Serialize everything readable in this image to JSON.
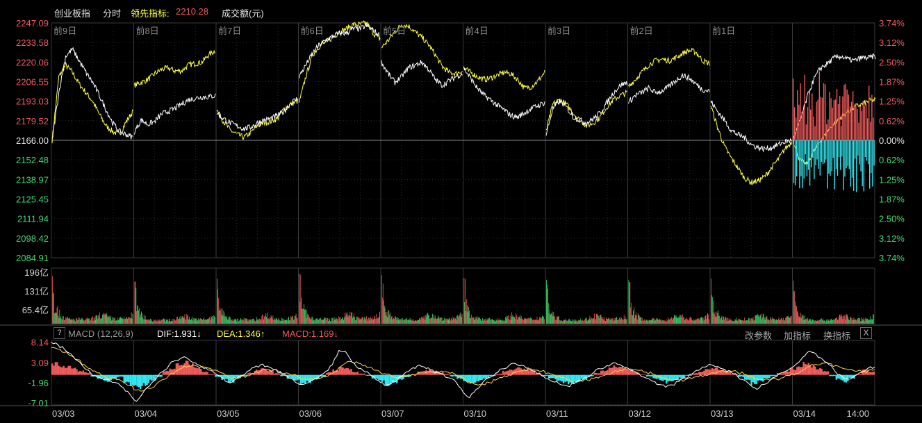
{
  "header": {
    "index_name": "创业板指",
    "mode": "分时",
    "leading_label": "领先指标:",
    "leading_value": "2210.28",
    "volume_label": "成交额(元)"
  },
  "colors": {
    "background": "#000000",
    "grid": "#2b2b2b",
    "up": "#f05b5b",
    "down": "#3fd96b",
    "price_line": "#ffffff",
    "leading_line": "#ffff40",
    "macd_neg": "#33e6f0",
    "dea": "#ffd54a"
  },
  "chart_data": [
    {
      "type": "line",
      "y_axis_left": [
        "2247.09",
        "2233.58",
        "2220.06",
        "2206.55",
        "2193.03",
        "2179.52",
        "2166.00",
        "2152.48",
        "2138.97",
        "2125.45",
        "2111.94",
        "2098.42",
        "2084.91"
      ],
      "y_axis_right": [
        "3.74%",
        "3.12%",
        "2.50%",
        "1.87%",
        "1.25%",
        "0.62%",
        "0.00%",
        "0.62%",
        "1.25%",
        "1.87%",
        "2.50%",
        "3.12%",
        "3.74%"
      ],
      "ylim": [
        2084.91,
        2247.09
      ],
      "baseline": 2166.0,
      "day_labels": [
        "前9日",
        "前8日",
        "前7日",
        "前6日",
        "前5日",
        "前4日",
        "前3日",
        "前2日",
        "前1日"
      ],
      "series": [
        {
          "name": "创业板指",
          "days": [
            [
              2166,
              2199,
              2224,
              2229,
              2221,
              2213,
              2206,
              2197,
              2187,
              2178,
              2172,
              2170,
              2168
            ],
            [
              2172,
              2180,
              2177,
              2179,
              2184,
              2186,
              2188,
              2191,
              2194,
              2195,
              2196,
              2196,
              2197
            ],
            [
              2185,
              2181,
              2178,
              2176,
              2174,
              2175,
              2178,
              2180,
              2181,
              2183,
              2186,
              2192,
              2195
            ],
            [
              2210,
              2218,
              2226,
              2232,
              2235,
              2238,
              2240,
              2240,
              2243,
              2243,
              2245,
              2242,
              2238
            ],
            [
              2220,
              2212,
              2206,
              2210,
              2216,
              2218,
              2220,
              2215,
              2208,
              2204,
              2207,
              2210,
              2212
            ],
            [
              2216,
              2209,
              2202,
              2197,
              2194,
              2190,
              2187,
              2183,
              2182,
              2185,
              2188,
              2190,
              2192
            ],
            [
              2170,
              2188,
              2193,
              2189,
              2182,
              2180,
              2178,
              2181,
              2185,
              2192,
              2199,
              2204,
              2206
            ],
            [
              2192,
              2197,
              2199,
              2202,
              2199,
              2200,
              2203,
              2207,
              2211,
              2209,
              2205,
              2201,
              2200
            ],
            [
              2193,
              2186,
              2180,
              2173,
              2170,
              2168,
              2163,
              2161,
              2160,
              2161,
              2163,
              2165,
              2166
            ],
            [
              2166,
              2179,
              2195,
              2208,
              2216,
              2219,
              2223,
              2224,
              2222,
              2221,
              2223,
              2223,
              2224
            ]
          ]
        },
        {
          "name": "领先指标",
          "days": [
            [
              2166,
              2210,
              2218,
              2213,
              2205,
              2199,
              2193,
              2184,
              2176,
              2172,
              2170,
              2179,
              2186
            ],
            [
              2204,
              2206,
              2208,
              2212,
              2215,
              2216,
              2214,
              2214,
              2218,
              2219,
              2220,
              2225,
              2228
            ],
            [
              2187,
              2179,
              2173,
              2170,
              2168,
              2171,
              2176,
              2178,
              2179,
              2181,
              2188,
              2191,
              2193
            ],
            [
              2192,
              2210,
              2225,
              2231,
              2234,
              2237,
              2241,
              2243,
              2246,
              2246,
              2247,
              2240,
              2236
            ],
            [
              2230,
              2235,
              2241,
              2246,
              2245,
              2241,
              2237,
              2232,
              2225,
              2217,
              2213,
              2212,
              2214
            ],
            [
              2216,
              2213,
              2210,
              2208,
              2209,
              2211,
              2213,
              2212,
              2208,
              2202,
              2203,
              2207,
              2213
            ],
            [
              2172,
              2191,
              2194,
              2191,
              2185,
              2180,
              2176,
              2178,
              2182,
              2189,
              2194,
              2197,
              2199
            ],
            [
              2203,
              2208,
              2213,
              2218,
              2221,
              2222,
              2221,
              2223,
              2226,
              2228,
              2227,
              2221,
              2219
            ],
            [
              2190,
              2175,
              2162,
              2154,
              2147,
              2140,
              2137,
              2138,
              2141,
              2147,
              2153,
              2160,
              2165
            ],
            [
              2166,
              2152,
              2149,
              2158,
              2166,
              2172,
              2178,
              2182,
              2186,
              2189,
              2191,
              2193,
              2194
            ]
          ]
        }
      ]
    },
    {
      "type": "bar",
      "y_axis_left": [
        "196亿",
        "131亿",
        "65.4亿"
      ],
      "ylim": [
        0,
        196
      ],
      "day_volume_profile": [
        120,
        62,
        46,
        34,
        28,
        24,
        20,
        18,
        16,
        14,
        14,
        14,
        16,
        16,
        15,
        14,
        14,
        16,
        14,
        15,
        18,
        20,
        22,
        26,
        30,
        30,
        28,
        26,
        22,
        20,
        18,
        18,
        16,
        16,
        17,
        18,
        18,
        20,
        22,
        24,
        28
      ],
      "day_scale": [
        1.0,
        0.88,
        0.94,
        1.05,
        1.02,
        0.96,
        0.92,
        0.92,
        0.95,
        0.9
      ]
    },
    {
      "type": "line",
      "title": "MACD (12,26,9)",
      "dif_label": "DIF:1.931",
      "dea_label": "DEA:1.346",
      "macd_label": "MACD:1.169",
      "y_axis_left": [
        "8.14",
        "3.09",
        "-1.96",
        "-7.01"
      ],
      "ylim": [
        -7.5,
        8.6
      ],
      "macd_histogram": [
        3,
        2.4,
        2.2,
        1.6,
        1,
        0.6,
        -0.4,
        -1.1,
        -1.6,
        -1.2,
        -0.5,
        -1.8,
        -2.6,
        -3.4,
        -2.4,
        -1.5,
        -0.6,
        0.9,
        1.8,
        2.6,
        3.2,
        2.5,
        1.6,
        0.8,
        0.2,
        -0.5,
        -1.2,
        -1.8,
        -0.9,
        -0.3,
        0.5,
        1.2,
        1.6,
        1.1,
        0.4,
        -0.3,
        -0.9,
        -1.5,
        -2.2,
        -1.9,
        -1.1,
        -0.4,
        0.6,
        1.3,
        1.8,
        1.6,
        0.8,
        0.3,
        -0.2,
        -0.9,
        -1.6,
        -2.5,
        -1.9,
        -1.2,
        -0.5,
        0.2,
        0.8,
        1.2,
        1.0,
        0.6,
        0.2,
        -0.4,
        -1.0,
        -1.6,
        -2.0,
        -1.5,
        -0.9,
        -0.3,
        0.3,
        0.9,
        1.4,
        1.8,
        1.5,
        1.0,
        0.4,
        -0.3,
        -0.8,
        -1.4,
        -1.9,
        -2.4,
        -1.8,
        -1.1,
        -0.4,
        0.5,
        1.0,
        1.6,
        2.2,
        1.8,
        1.3,
        0.7,
        0.1,
        -0.4,
        -0.9,
        -1.4,
        -1.9,
        -1.4,
        -0.8,
        -0.2,
        0.4,
        0.9,
        1.4,
        1.7,
        1.3,
        0.9,
        0.3,
        -0.5,
        -1.2,
        -2.3,
        -1.5,
        -0.9,
        -0.3,
        0.4,
        1.0,
        1.6,
        2.3,
        2.9,
        2.4,
        1.6,
        0.9,
        -0.3,
        -1.2,
        -1.8,
        -0.9,
        0.2,
        1.3,
        0.9
      ],
      "dif": [
        8.1,
        7.5,
        6.4,
        5.2,
        3.5,
        1.8,
        0.5,
        -0.6,
        -1.2,
        -1.5,
        -2.0,
        -3.2,
        -4.8,
        -6.6,
        -4.5,
        -2.8,
        -1.0,
        0.8,
        2.4,
        3.6,
        4.3,
        3.9,
        3.0,
        2.0,
        1.2,
        0.4,
        -0.6,
        -1.8,
        -1.3,
        -0.2,
        0.9,
        1.8,
        2.5,
        2.2,
        1.3,
        0.6,
        -0.3,
        -1.2,
        -2.4,
        -2.1,
        -1.3,
        -0.4,
        0.9,
        2.5,
        6.1,
        5.8,
        3.2,
        1.6,
        0.7,
        -0.3,
        -1.4,
        -2.6,
        -2.2,
        -1.1,
        0.3,
        1.4,
        2.3,
        2.0,
        1.3,
        0.6,
        0.1,
        -0.8,
        -2.0,
        -4.3,
        -5.7,
        -3.6,
        -1.9,
        -0.7,
        0.4,
        1.5,
        2.3,
        2.8,
        2.4,
        1.7,
        0.9,
        -0.2,
        -1.0,
        -1.8,
        -2.5,
        -2.8,
        -2.2,
        -1.5,
        -0.6,
        0.6,
        1.5,
        2.3,
        3.0,
        2.6,
        1.8,
        1.0,
        0.1,
        -0.8,
        -1.6,
        -2.4,
        -3.1,
        -2.5,
        -1.7,
        -0.8,
        0.2,
        1.1,
        1.9,
        2.5,
        2.1,
        1.4,
        0.7,
        -0.4,
        -1.3,
        -2.6,
        -3.6,
        -2.4,
        -1.3,
        -0.4,
        0.6,
        1.5,
        2.7,
        4.4,
        5.9,
        5.2,
        3.9,
        2.5,
        0.7,
        -0.4,
        -1.1,
        -0.2,
        0.6,
        1.7,
        1.9
      ],
      "dea": [
        6.8,
        6.4,
        5.6,
        4.8,
        3.8,
        2.6,
        1.5,
        0.5,
        -0.3,
        -0.8,
        -1.2,
        -1.8,
        -2.7,
        -3.8,
        -4.0,
        -3.4,
        -2.4,
        -1.2,
        -0.1,
        0.9,
        1.7,
        2.2,
        2.3,
        2.1,
        1.7,
        1.2,
        0.5,
        -0.3,
        -0.6,
        -0.5,
        -0.2,
        0.3,
        0.9,
        1.2,
        1.2,
        0.9,
        0.5,
        0.0,
        -0.7,
        -1.1,
        -1.2,
        -1.0,
        -0.5,
        0.3,
        1.8,
        2.9,
        3.2,
        2.9,
        2.4,
        1.8,
        1.1,
        0.3,
        -0.3,
        -0.6,
        -0.5,
        -0.1,
        0.4,
        0.8,
        0.9,
        0.9,
        0.7,
        0.4,
        -0.1,
        -1.0,
        -2.0,
        -2.4,
        -2.3,
        -1.9,
        -1.3,
        -0.7,
        0.0,
        0.6,
        1.0,
        1.2,
        1.2,
        0.9,
        0.5,
        -0.1,
        -0.7,
        -1.2,
        -1.5,
        -1.5,
        -1.3,
        -0.9,
        -0.4,
        0.2,
        0.8,
        1.2,
        1.4,
        1.3,
        1.1,
        0.7,
        0.2,
        -0.3,
        -0.8,
        -1.2,
        -1.3,
        -1.2,
        -0.9,
        -0.5,
        0.0,
        0.5,
        0.8,
        0.9,
        0.9,
        0.6,
        0.2,
        -0.4,
        -1.0,
        -1.3,
        -1.3,
        -1.1,
        -0.7,
        -0.2,
        0.4,
        1.2,
        2.1,
        2.6,
        2.9,
        2.8,
        2.3,
        1.7,
        1.2,
        0.9,
        0.8,
        1.0,
        1.3
      ]
    }
  ],
  "x_axis": {
    "dates": [
      "03/03",
      "03/04",
      "03/05",
      "03/06",
      "03/07",
      "03/10",
      "03/11",
      "03/12",
      "03/13",
      "03/14",
      "14:00"
    ]
  },
  "toolbar": {
    "help": "?",
    "param_btn": "改参数",
    "add_btn": "加指标",
    "switch_btn": "换指标",
    "close": "X"
  }
}
